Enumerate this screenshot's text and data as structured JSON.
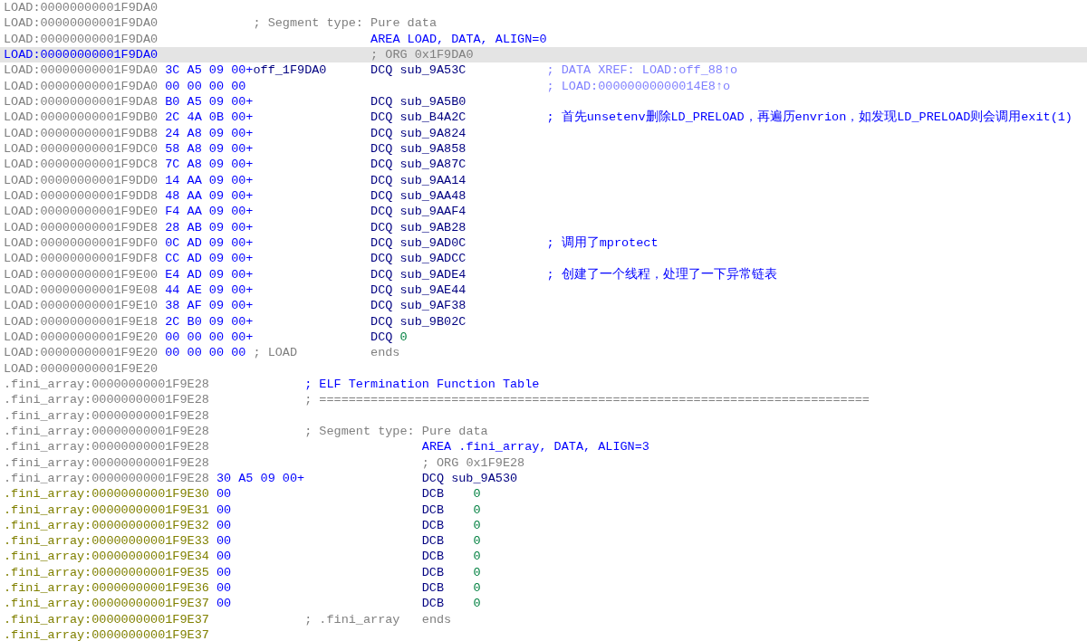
{
  "sections": [
    {
      "kind": "load",
      "lines": [
        {
          "address": "LOAD:00000000001F9DA0",
          "color": "#808080",
          "selected": false
        },
        {
          "address": "LOAD:00000000001F9DA0",
          "color": "#808080",
          "selected": false,
          "parts": [
            {
              "kind": "note",
              "text": "; Segment type: Pure data"
            }
          ]
        },
        {
          "address": "LOAD:00000000001F9DA0",
          "color": "#808080",
          "selected": false,
          "parts": [
            {
              "kind": "directive",
              "text": "AREA LOAD, DATA, ALIGN=0"
            }
          ]
        },
        {
          "address": "LOAD:00000000001F9DA0",
          "color": "#0000ff",
          "selected": true,
          "parts": [
            {
              "kind": "muted",
              "text": "; ORG 0x1F9DA0"
            }
          ]
        },
        {
          "address": "LOAD:00000000001F9DA0",
          "color": "#808080",
          "selected": false,
          "kind": "qword",
          "parts": [
            {
              "kind": "bytes",
              "text": "3C A5 09 00+"
            },
            {
              "kind": "label",
              "text": "off_1F9DA0"
            },
            {
              "kind": "mnemonic",
              "text": "DCQ"
            },
            {
              "kind": "symbol",
              "text": "sub_9A53C"
            },
            {
              "kind": "xref",
              "text": "; DATA XREF: LOAD:off_88↑o"
            }
          ]
        },
        {
          "address": "LOAD:00000000001F9DA0",
          "color": "#808080",
          "selected": false,
          "parts": [
            {
              "kind": "bytes",
              "text": "00 00 00 00"
            },
            {
              "kind": "xref",
              "text": "; LOAD:00000000000014E8↑o"
            }
          ]
        },
        {
          "address": "LOAD:00000000001F9DA8",
          "color": "#808080",
          "selected": false,
          "kind": "qword",
          "parts": [
            {
              "kind": "bytes",
              "text": "B0 A5 09 00+"
            },
            {
              "kind": "mnemonic",
              "text": "DCQ"
            },
            {
              "kind": "symbol",
              "text": "sub_9A5B0"
            }
          ]
        },
        {
          "address": "LOAD:00000000001F9DB0",
          "color": "#808080",
          "selected": false,
          "kind": "qword",
          "parts": [
            {
              "kind": "bytes",
              "text": "2C 4A 0B 00+"
            },
            {
              "kind": "mnemonic",
              "text": "DCQ"
            },
            {
              "kind": "symbol",
              "text": "sub_B4A2C"
            },
            {
              "kind": "remark",
              "text": "; 首先unsetenv删除LD_PRELOAD，再遍历envrion，如发现LD_PRELOAD则会调用exit(1)"
            }
          ]
        },
        {
          "address": "LOAD:00000000001F9DB8",
          "color": "#808080",
          "selected": false,
          "kind": "qword",
          "parts": [
            {
              "kind": "bytes",
              "text": "24 A8 09 00+"
            },
            {
              "kind": "mnemonic",
              "text": "DCQ"
            },
            {
              "kind": "symbol",
              "text": "sub_9A824"
            }
          ]
        },
        {
          "address": "LOAD:00000000001F9DC0",
          "color": "#808080",
          "selected": false,
          "kind": "qword",
          "parts": [
            {
              "kind": "bytes",
              "text": "58 A8 09 00+"
            },
            {
              "kind": "mnemonic",
              "text": "DCQ"
            },
            {
              "kind": "symbol",
              "text": "sub_9A858"
            }
          ]
        },
        {
          "address": "LOAD:00000000001F9DC8",
          "color": "#808080",
          "selected": false,
          "kind": "qword",
          "parts": [
            {
              "kind": "bytes",
              "text": "7C A8 09 00+"
            },
            {
              "kind": "mnemonic",
              "text": "DCQ"
            },
            {
              "kind": "symbol",
              "text": "sub_9A87C"
            }
          ]
        },
        {
          "address": "LOAD:00000000001F9DD0",
          "color": "#808080",
          "selected": false,
          "kind": "qword",
          "parts": [
            {
              "kind": "bytes",
              "text": "14 AA 09 00+"
            },
            {
              "kind": "mnemonic",
              "text": "DCQ"
            },
            {
              "kind": "symbol",
              "text": "sub_9AA14"
            }
          ]
        },
        {
          "address": "LOAD:00000000001F9DD8",
          "color": "#808080",
          "selected": false,
          "kind": "qword",
          "parts": [
            {
              "kind": "bytes",
              "text": "48 AA 09 00+"
            },
            {
              "kind": "mnemonic",
              "text": "DCQ"
            },
            {
              "kind": "symbol",
              "text": "sub_9AA48"
            }
          ]
        },
        {
          "address": "LOAD:00000000001F9DE0",
          "color": "#808080",
          "selected": false,
          "kind": "qword",
          "parts": [
            {
              "kind": "bytes",
              "text": "F4 AA 09 00+"
            },
            {
              "kind": "mnemonic",
              "text": "DCQ"
            },
            {
              "kind": "symbol",
              "text": "sub_9AAF4"
            }
          ]
        },
        {
          "address": "LOAD:00000000001F9DE8",
          "color": "#808080",
          "selected": false,
          "kind": "qword",
          "parts": [
            {
              "kind": "bytes",
              "text": "28 AB 09 00+"
            },
            {
              "kind": "mnemonic",
              "text": "DCQ"
            },
            {
              "kind": "symbol",
              "text": "sub_9AB28"
            }
          ]
        },
        {
          "address": "LOAD:00000000001F9DF0",
          "color": "#808080",
          "selected": false,
          "kind": "qword",
          "parts": [
            {
              "kind": "bytes",
              "text": "0C AD 09 00+"
            },
            {
              "kind": "mnemonic",
              "text": "DCQ"
            },
            {
              "kind": "symbol",
              "text": "sub_9AD0C"
            },
            {
              "kind": "remark",
              "text": "; 调用了mprotect"
            }
          ]
        },
        {
          "address": "LOAD:00000000001F9DF8",
          "color": "#808080",
          "selected": false,
          "kind": "qword",
          "parts": [
            {
              "kind": "bytes",
              "text": "CC AD 09 00+"
            },
            {
              "kind": "mnemonic",
              "text": "DCQ"
            },
            {
              "kind": "symbol",
              "text": "sub_9ADCC"
            }
          ]
        },
        {
          "address": "LOAD:00000000001F9E00",
          "color": "#808080",
          "selected": false,
          "kind": "qword",
          "parts": [
            {
              "kind": "bytes",
              "text": "E4 AD 09 00+"
            },
            {
              "kind": "mnemonic",
              "text": "DCQ"
            },
            {
              "kind": "symbol",
              "text": "sub_9ADE4"
            },
            {
              "kind": "remark",
              "text": "; 创建了一个线程，处理了一下异常链表"
            }
          ]
        },
        {
          "address": "LOAD:00000000001F9E08",
          "color": "#808080",
          "selected": false,
          "kind": "qword",
          "parts": [
            {
              "kind": "bytes",
              "text": "44 AE 09 00+"
            },
            {
              "kind": "mnemonic",
              "text": "DCQ"
            },
            {
              "kind": "symbol",
              "text": "sub_9AE44"
            }
          ]
        },
        {
          "address": "LOAD:00000000001F9E10",
          "color": "#808080",
          "selected": false,
          "kind": "qword",
          "parts": [
            {
              "kind": "bytes",
              "text": "38 AF 09 00+"
            },
            {
              "kind": "mnemonic",
              "text": "DCQ"
            },
            {
              "kind": "symbol",
              "text": "sub_9AF38"
            }
          ]
        },
        {
          "address": "LOAD:00000000001F9E18",
          "color": "#808080",
          "selected": false,
          "kind": "qword",
          "parts": [
            {
              "kind": "bytes",
              "text": "2C B0 09 00+"
            },
            {
              "kind": "mnemonic",
              "text": "DCQ"
            },
            {
              "kind": "symbol",
              "text": "sub_9B02C"
            }
          ]
        },
        {
          "address": "LOAD:00000000001F9E20",
          "color": "#808080",
          "selected": false,
          "kind": "qword",
          "parts": [
            {
              "kind": "bytes",
              "text": "00 00 00 00+"
            },
            {
              "kind": "mnemonic",
              "text": "DCQ"
            },
            {
              "kind": "number",
              "text": "0"
            }
          ]
        },
        {
          "address": "LOAD:00000000001F9E20",
          "color": "#808080",
          "selected": false,
          "parts": [
            {
              "kind": "bytes",
              "text": "00 00 00 00"
            },
            {
              "kind": "note",
              "text": "; LOAD"
            },
            {
              "kind": "muted",
              "text": "ends"
            }
          ]
        },
        {
          "address": "LOAD:00000000001F9E20",
          "color": "#808080",
          "selected": false
        }
      ]
    },
    {
      "kind": "fini",
      "lines": [
        {
          "address": ".fini_array:00000000001F9E28",
          "color": "#808080",
          "selected": false,
          "parts": [
            {
              "kind": "title",
              "text": "; ELF Termination Function Table"
            }
          ]
        },
        {
          "address": ".fini_array:00000000001F9E28",
          "color": "#808080",
          "selected": false,
          "parts": [
            {
              "kind": "note",
              "text": "; ==========================================================================="
            }
          ]
        },
        {
          "address": ".fini_array:00000000001F9E28",
          "color": "#808080",
          "selected": false
        },
        {
          "address": ".fini_array:00000000001F9E28",
          "color": "#808080",
          "selected": false,
          "parts": [
            {
              "kind": "note",
              "text": "; Segment type: Pure data"
            }
          ]
        },
        {
          "address": ".fini_array:00000000001F9E28",
          "color": "#808080",
          "selected": false,
          "parts": [
            {
              "kind": "directive",
              "text": "AREA .fini_array, DATA, ALIGN=3"
            }
          ]
        },
        {
          "address": ".fini_array:00000000001F9E28",
          "color": "#808080",
          "selected": false,
          "parts": [
            {
              "kind": "muted",
              "text": "; ORG 0x1F9E28"
            }
          ]
        },
        {
          "address": ".fini_array:00000000001F9E28",
          "color": "#808080",
          "selected": false,
          "kind": "qword",
          "parts": [
            {
              "kind": "bytes",
              "text": "30 A5 09 00+"
            },
            {
              "kind": "mnemonic",
              "text": "DCQ"
            },
            {
              "kind": "symbol",
              "text": "sub_9A530"
            }
          ]
        },
        {
          "address": ".fini_array:00000000001F9E30",
          "color": "#808000",
          "selected": false,
          "kind": "byte",
          "parts": [
            {
              "kind": "bytes",
              "text": "00"
            },
            {
              "kind": "mnemonic",
              "text": "DCB"
            },
            {
              "kind": "number",
              "text": "0"
            }
          ]
        },
        {
          "address": ".fini_array:00000000001F9E31",
          "color": "#808000",
          "selected": false,
          "kind": "byte",
          "parts": [
            {
              "kind": "bytes",
              "text": "00"
            },
            {
              "kind": "mnemonic",
              "text": "DCB"
            },
            {
              "kind": "number",
              "text": "0"
            }
          ]
        },
        {
          "address": ".fini_array:00000000001F9E32",
          "color": "#808000",
          "selected": false,
          "kind": "byte",
          "parts": [
            {
              "kind": "bytes",
              "text": "00"
            },
            {
              "kind": "mnemonic",
              "text": "DCB"
            },
            {
              "kind": "number",
              "text": "0"
            }
          ]
        },
        {
          "address": ".fini_array:00000000001F9E33",
          "color": "#808000",
          "selected": false,
          "kind": "byte",
          "parts": [
            {
              "kind": "bytes",
              "text": "00"
            },
            {
              "kind": "mnemonic",
              "text": "DCB"
            },
            {
              "kind": "number",
              "text": "0"
            }
          ]
        },
        {
          "address": ".fini_array:00000000001F9E34",
          "color": "#808000",
          "selected": false,
          "kind": "byte",
          "parts": [
            {
              "kind": "bytes",
              "text": "00"
            },
            {
              "kind": "mnemonic",
              "text": "DCB"
            },
            {
              "kind": "number",
              "text": "0"
            }
          ]
        },
        {
          "address": ".fini_array:00000000001F9E35",
          "color": "#808000",
          "selected": false,
          "kind": "byte",
          "parts": [
            {
              "kind": "bytes",
              "text": "00"
            },
            {
              "kind": "mnemonic",
              "text": "DCB"
            },
            {
              "kind": "number",
              "text": "0"
            }
          ]
        },
        {
          "address": ".fini_array:00000000001F9E36",
          "color": "#808000",
          "selected": false,
          "kind": "byte",
          "parts": [
            {
              "kind": "bytes",
              "text": "00"
            },
            {
              "kind": "mnemonic",
              "text": "DCB"
            },
            {
              "kind": "number",
              "text": "0"
            }
          ]
        },
        {
          "address": ".fini_array:00000000001F9E37",
          "color": "#808000",
          "selected": false,
          "kind": "byte",
          "parts": [
            {
              "kind": "bytes",
              "text": "00"
            },
            {
              "kind": "mnemonic",
              "text": "DCB"
            },
            {
              "kind": "number",
              "text": "0"
            }
          ]
        },
        {
          "address": ".fini_array:00000000001F9E37",
          "color": "#808000",
          "selected": false,
          "parts": [
            {
              "kind": "note",
              "text": "; .fini_array"
            },
            {
              "kind": "muted",
              "text": "ends"
            }
          ]
        },
        {
          "address": ".fini_array:00000000001F9E37",
          "color": "#808000",
          "selected": false
        }
      ]
    }
  ]
}
